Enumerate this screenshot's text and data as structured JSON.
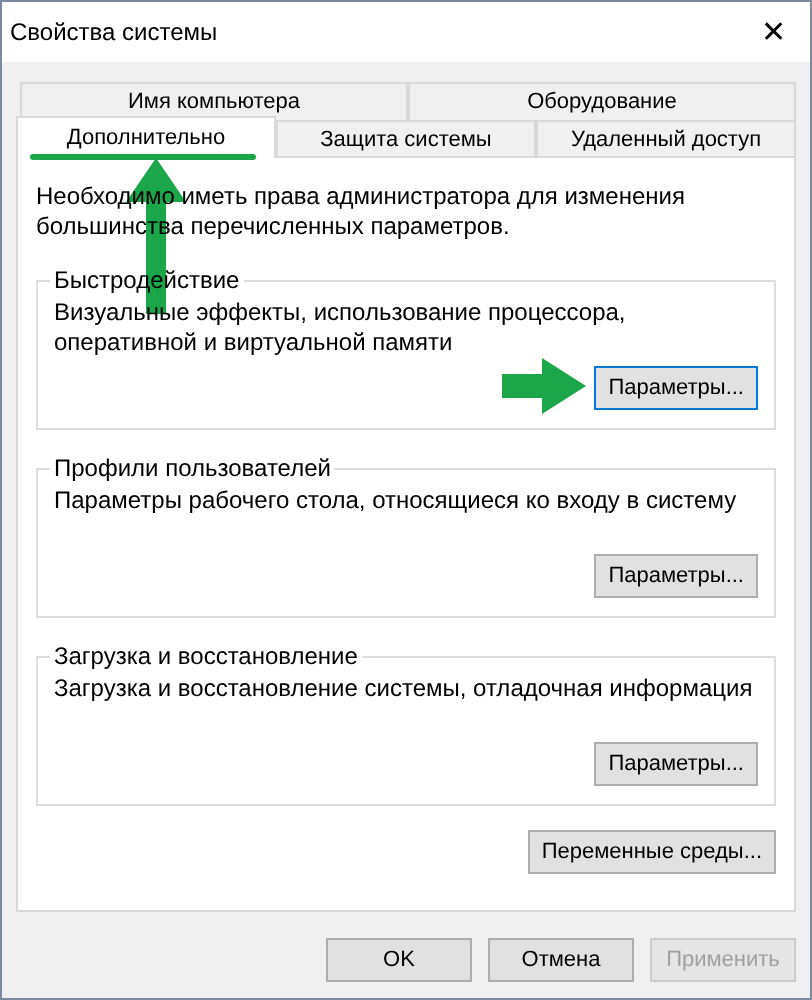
{
  "window": {
    "title": "Свойства системы",
    "close": "✕"
  },
  "tabs": [
    [
      {
        "label": "Имя компьютера",
        "selected": false
      },
      {
        "label": "Оборудование",
        "selected": false
      }
    ],
    [
      {
        "label": "Дополнительно",
        "selected": true
      },
      {
        "label": "Защита системы",
        "selected": false
      },
      {
        "label": "Удаленный доступ",
        "selected": false
      }
    ]
  ],
  "note": "Необходимо иметь права администратора для изменения большинства перечисленных параметров.",
  "groups": [
    {
      "title": "Быстродействие",
      "text": "Визуальные эффекты, использование процессора, оперативной и виртуальной памяти",
      "button": "Параметры...",
      "focused": true
    },
    {
      "title": "Профили пользователей",
      "text": "Параметры рабочего стола, относящиеся ко входу в систему",
      "button": "Параметры...",
      "focused": false
    },
    {
      "title": "Загрузка и восстановление",
      "text": "Загрузка и восстановление системы, отладочная информация",
      "button": "Параметры...",
      "focused": false
    }
  ],
  "env_button": "Переменные среды...",
  "buttons": [
    {
      "label": "OK",
      "disabled": false
    },
    {
      "label": "Отмена",
      "disabled": false
    },
    {
      "label": "Применить",
      "disabled": true
    }
  ]
}
